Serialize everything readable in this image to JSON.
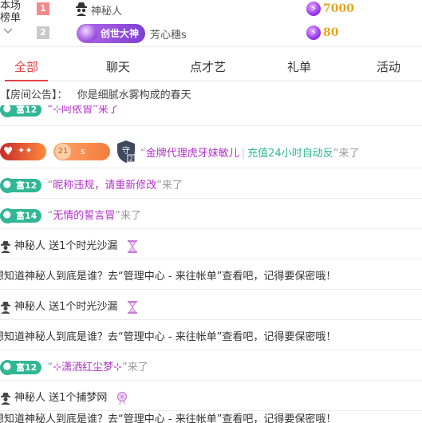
{
  "leaderboard": {
    "side_label": [
      "本场",
      "榜单"
    ],
    "chevron": "chevron-down-icon",
    "rows": [
      {
        "rank": "1",
        "badge": "",
        "name": "神秘人",
        "score": "7000",
        "icon": "incognito-icon"
      },
      {
        "rank": "2",
        "badge": "创世大神",
        "name": "芳心穗s",
        "score": "80",
        "icon": ""
      }
    ]
  },
  "tabs": [
    {
      "label": "全部",
      "active": true
    },
    {
      "label": "聊天",
      "active": false
    },
    {
      "label": "点才艺",
      "active": false
    },
    {
      "label": "礼单",
      "active": false
    },
    {
      "label": "活动",
      "active": false
    }
  ],
  "notice": {
    "prefix": "【房间公告】：",
    "text": "你是细腻水雾构成的春天"
  },
  "messages": {
    "m0": {
      "badge": "富12",
      "text": "“⊹阿依曾”来了"
    },
    "m1": {
      "vip_text": "♥",
      "level": "21",
      "level_suffix": "s",
      "shield_level": "2",
      "open_quote": "“",
      "nick": "金牌代理虎牙妹敏儿",
      "extra": "充值24小时自动反",
      "close": "”来了"
    },
    "m2": {
      "badge": "富12",
      "open": "“",
      "nick": "昵称违规，请重新修改",
      "close": "”来了"
    },
    "m3": {
      "badge": "富14",
      "open": "“",
      "nick": "无情的誓言冒",
      "close": "”来了"
    },
    "m4": {
      "sender": "神秘人",
      "text": "送1个时光沙漏"
    },
    "m5": {
      "text": "想知道神秘人到底是谁？去“管理中心 - 来往帐单”查看吧，记得要保密哦！"
    },
    "m6": {
      "sender": "神秘人",
      "text": "送1个时光沙漏"
    },
    "m7": {
      "text": "想知道神秘人到底是谁？去“管理中心 - 来往帐单”查看吧，记得要保密哦！"
    },
    "m8": {
      "badge": "富12",
      "open": "“",
      "nick": "⊹潇洒红尘梦⊹",
      "close": "”来了"
    },
    "m9": {
      "sender": "神秘人",
      "text": "送1个捕梦网"
    },
    "m10": {
      "text": "想知道神秘人到底是谁？去“管理中心 - 来往帐单”查看吧，记得要保密哦！"
    }
  },
  "colors": {
    "accent": "#e2434a",
    "nick": "#b232c9",
    "badge_green": "#31b795",
    "score": "#e8a21b"
  }
}
